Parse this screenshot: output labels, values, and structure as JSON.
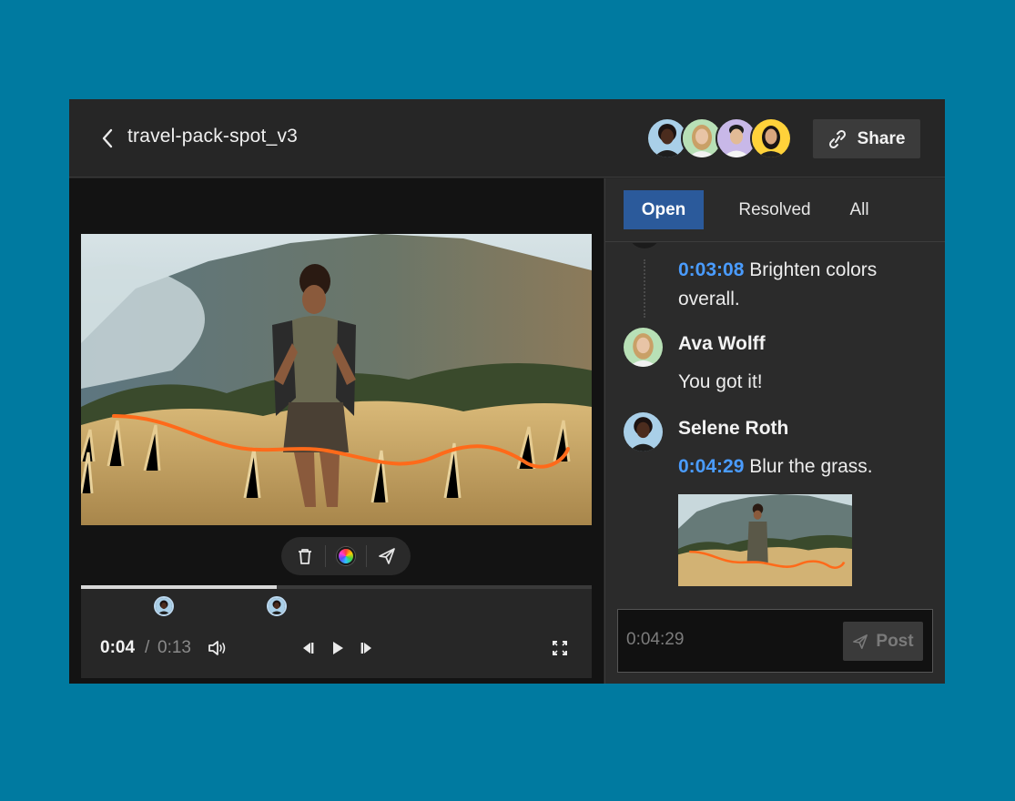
{
  "header": {
    "title": "travel-pack-spot_v3",
    "share_label": "Share",
    "collaborators": [
      {
        "bg": "#a9cfe8",
        "skin": "#4b2c1e",
        "hair": "#1b1211"
      },
      {
        "bg": "#b8e0b6",
        "skin": "#e8c4a6",
        "hair": "#c9a067"
      },
      {
        "bg": "#c8b8e8",
        "skin": "#e2bb96",
        "hair": "#1c1c1c"
      },
      {
        "bg": "#ffd23a",
        "skin": "#d9a57c",
        "hair": "#1a1414"
      }
    ]
  },
  "player": {
    "current_time": "0:04",
    "separator": "/",
    "total_time": "0:13",
    "progress": 0.384,
    "markers": [
      0.162,
      0.383
    ]
  },
  "tabs": [
    {
      "label": "Open",
      "active": true
    },
    {
      "label": "Resolved",
      "active": false
    },
    {
      "label": "All",
      "active": false
    }
  ],
  "comments": [
    {
      "author": "",
      "timestamp": "0:03:08",
      "text": "Brighten colors overall."
    },
    {
      "author": "Ava Wolff",
      "timestamp": "",
      "text": "You got it!"
    },
    {
      "author": "Selene Roth",
      "timestamp": "0:04:29",
      "text": "Blur the grass."
    }
  ],
  "composer": {
    "value": "0:04:29",
    "post_label": "Post"
  },
  "colors": {
    "accent": "#2b5a9b",
    "timestamp": "#4a9cff",
    "annotation": "#ff6a1a",
    "background": "#007aa0"
  }
}
